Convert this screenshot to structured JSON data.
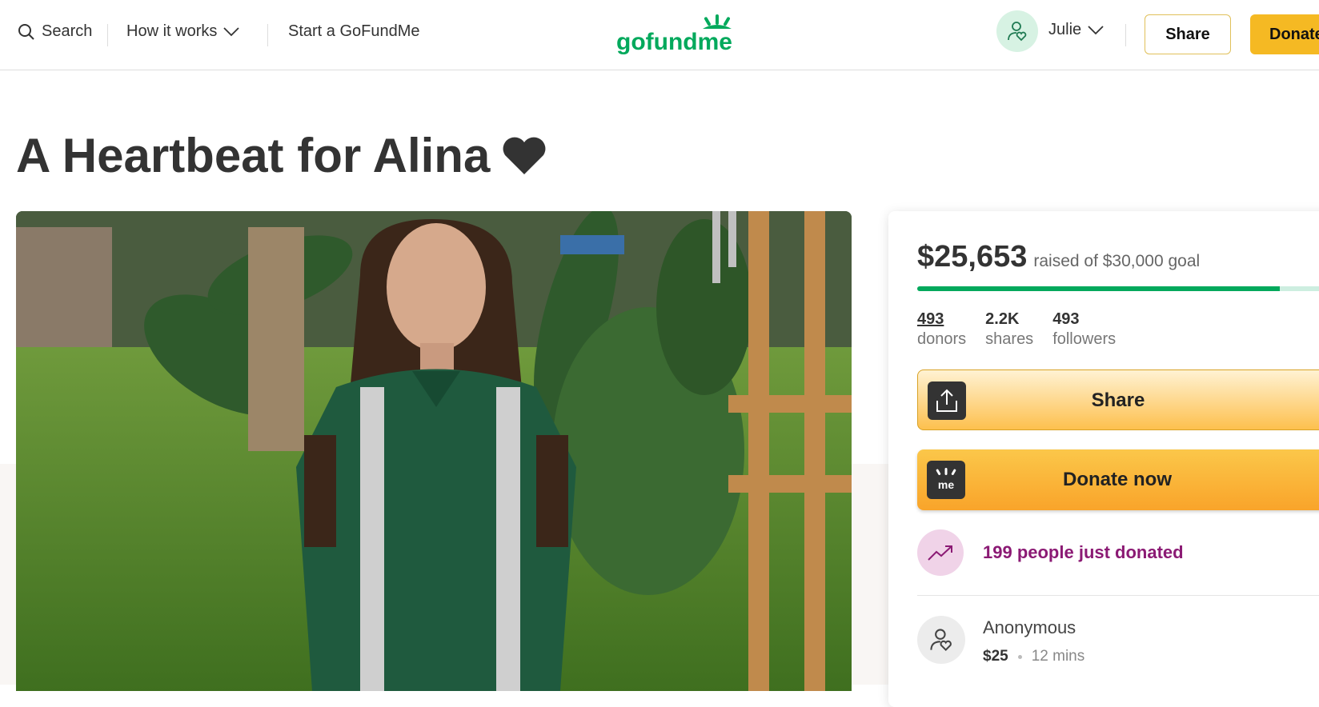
{
  "nav": {
    "search_label": "Search",
    "how_it_works_label": "How it works",
    "start_label": "Start a GoFundMe",
    "logo_text": "gofundme",
    "user_name": "Julie",
    "share_label": "Share",
    "donate_label": "Donate"
  },
  "campaign": {
    "title": "A Heartbeat for Alina",
    "heart_icon": "heart-icon"
  },
  "panel": {
    "raised_amount": "$25,653",
    "goal_text": "raised of $30,000 goal",
    "progress_fraction": 0.855,
    "stats": [
      {
        "value": "493",
        "label": "donors"
      },
      {
        "value": "2.2K",
        "label": "shares"
      },
      {
        "value": "493",
        "label": "followers"
      }
    ],
    "share_button": "Share",
    "donate_button": "Donate now",
    "donate_icon_text": "me",
    "trend_text": "199 people just donated",
    "recent_donation": {
      "name": "Anonymous",
      "amount": "$25",
      "time": "12 mins"
    }
  },
  "colors": {
    "brand_green": "#02a95c",
    "donate_yellow": "#f5b923",
    "trend_purple": "#8b1a74"
  }
}
